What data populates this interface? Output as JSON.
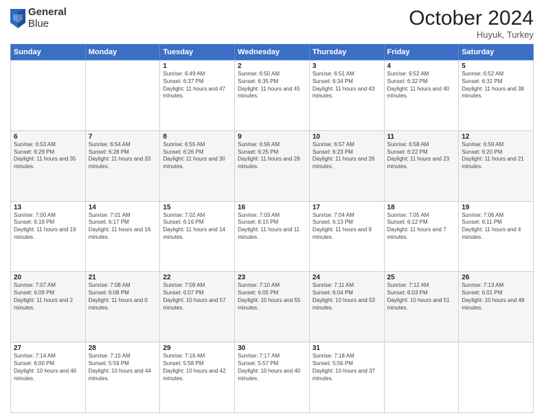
{
  "header": {
    "logo_line1": "General",
    "logo_line2": "Blue",
    "month": "October 2024",
    "location": "Huyuk, Turkey"
  },
  "days_of_week": [
    "Sunday",
    "Monday",
    "Tuesday",
    "Wednesday",
    "Thursday",
    "Friday",
    "Saturday"
  ],
  "weeks": [
    [
      {
        "day": "",
        "content": ""
      },
      {
        "day": "",
        "content": ""
      },
      {
        "day": "1",
        "content": "Sunrise: 6:49 AM\nSunset: 6:37 PM\nDaylight: 11 hours and 47 minutes."
      },
      {
        "day": "2",
        "content": "Sunrise: 6:50 AM\nSunset: 6:35 PM\nDaylight: 11 hours and 45 minutes."
      },
      {
        "day": "3",
        "content": "Sunrise: 6:51 AM\nSunset: 6:34 PM\nDaylight: 11 hours and 43 minutes."
      },
      {
        "day": "4",
        "content": "Sunrise: 6:52 AM\nSunset: 6:32 PM\nDaylight: 11 hours and 40 minutes."
      },
      {
        "day": "5",
        "content": "Sunrise: 6:52 AM\nSunset: 6:31 PM\nDaylight: 11 hours and 38 minutes."
      }
    ],
    [
      {
        "day": "6",
        "content": "Sunrise: 6:53 AM\nSunset: 6:29 PM\nDaylight: 11 hours and 35 minutes."
      },
      {
        "day": "7",
        "content": "Sunrise: 6:54 AM\nSunset: 6:28 PM\nDaylight: 11 hours and 33 minutes."
      },
      {
        "day": "8",
        "content": "Sunrise: 6:55 AM\nSunset: 6:26 PM\nDaylight: 11 hours and 30 minutes."
      },
      {
        "day": "9",
        "content": "Sunrise: 6:56 AM\nSunset: 6:25 PM\nDaylight: 11 hours and 28 minutes."
      },
      {
        "day": "10",
        "content": "Sunrise: 6:57 AM\nSunset: 6:23 PM\nDaylight: 11 hours and 26 minutes."
      },
      {
        "day": "11",
        "content": "Sunrise: 6:58 AM\nSunset: 6:22 PM\nDaylight: 11 hours and 23 minutes."
      },
      {
        "day": "12",
        "content": "Sunrise: 6:59 AM\nSunset: 6:20 PM\nDaylight: 11 hours and 21 minutes."
      }
    ],
    [
      {
        "day": "13",
        "content": "Sunrise: 7:00 AM\nSunset: 6:19 PM\nDaylight: 11 hours and 19 minutes."
      },
      {
        "day": "14",
        "content": "Sunrise: 7:01 AM\nSunset: 6:17 PM\nDaylight: 11 hours and 16 minutes."
      },
      {
        "day": "15",
        "content": "Sunrise: 7:02 AM\nSunset: 6:16 PM\nDaylight: 11 hours and 14 minutes."
      },
      {
        "day": "16",
        "content": "Sunrise: 7:03 AM\nSunset: 6:15 PM\nDaylight: 11 hours and 11 minutes."
      },
      {
        "day": "17",
        "content": "Sunrise: 7:04 AM\nSunset: 6:13 PM\nDaylight: 11 hours and 9 minutes."
      },
      {
        "day": "18",
        "content": "Sunrise: 7:05 AM\nSunset: 6:12 PM\nDaylight: 11 hours and 7 minutes."
      },
      {
        "day": "19",
        "content": "Sunrise: 7:06 AM\nSunset: 6:11 PM\nDaylight: 11 hours and 4 minutes."
      }
    ],
    [
      {
        "day": "20",
        "content": "Sunrise: 7:07 AM\nSunset: 6:09 PM\nDaylight: 11 hours and 2 minutes."
      },
      {
        "day": "21",
        "content": "Sunrise: 7:08 AM\nSunset: 6:08 PM\nDaylight: 11 hours and 0 minutes."
      },
      {
        "day": "22",
        "content": "Sunrise: 7:09 AM\nSunset: 6:07 PM\nDaylight: 10 hours and 57 minutes."
      },
      {
        "day": "23",
        "content": "Sunrise: 7:10 AM\nSunset: 6:05 PM\nDaylight: 10 hours and 55 minutes."
      },
      {
        "day": "24",
        "content": "Sunrise: 7:11 AM\nSunset: 6:04 PM\nDaylight: 10 hours and 53 minutes."
      },
      {
        "day": "25",
        "content": "Sunrise: 7:12 AM\nSunset: 6:03 PM\nDaylight: 10 hours and 51 minutes."
      },
      {
        "day": "26",
        "content": "Sunrise: 7:13 AM\nSunset: 6:01 PM\nDaylight: 10 hours and 48 minutes."
      }
    ],
    [
      {
        "day": "27",
        "content": "Sunrise: 7:14 AM\nSunset: 6:00 PM\nDaylight: 10 hours and 46 minutes."
      },
      {
        "day": "28",
        "content": "Sunrise: 7:15 AM\nSunset: 5:59 PM\nDaylight: 10 hours and 44 minutes."
      },
      {
        "day": "29",
        "content": "Sunrise: 7:16 AM\nSunset: 5:58 PM\nDaylight: 10 hours and 42 minutes."
      },
      {
        "day": "30",
        "content": "Sunrise: 7:17 AM\nSunset: 5:57 PM\nDaylight: 10 hours and 40 minutes."
      },
      {
        "day": "31",
        "content": "Sunrise: 7:18 AM\nSunset: 5:56 PM\nDaylight: 10 hours and 37 minutes."
      },
      {
        "day": "",
        "content": ""
      },
      {
        "day": "",
        "content": ""
      }
    ]
  ]
}
